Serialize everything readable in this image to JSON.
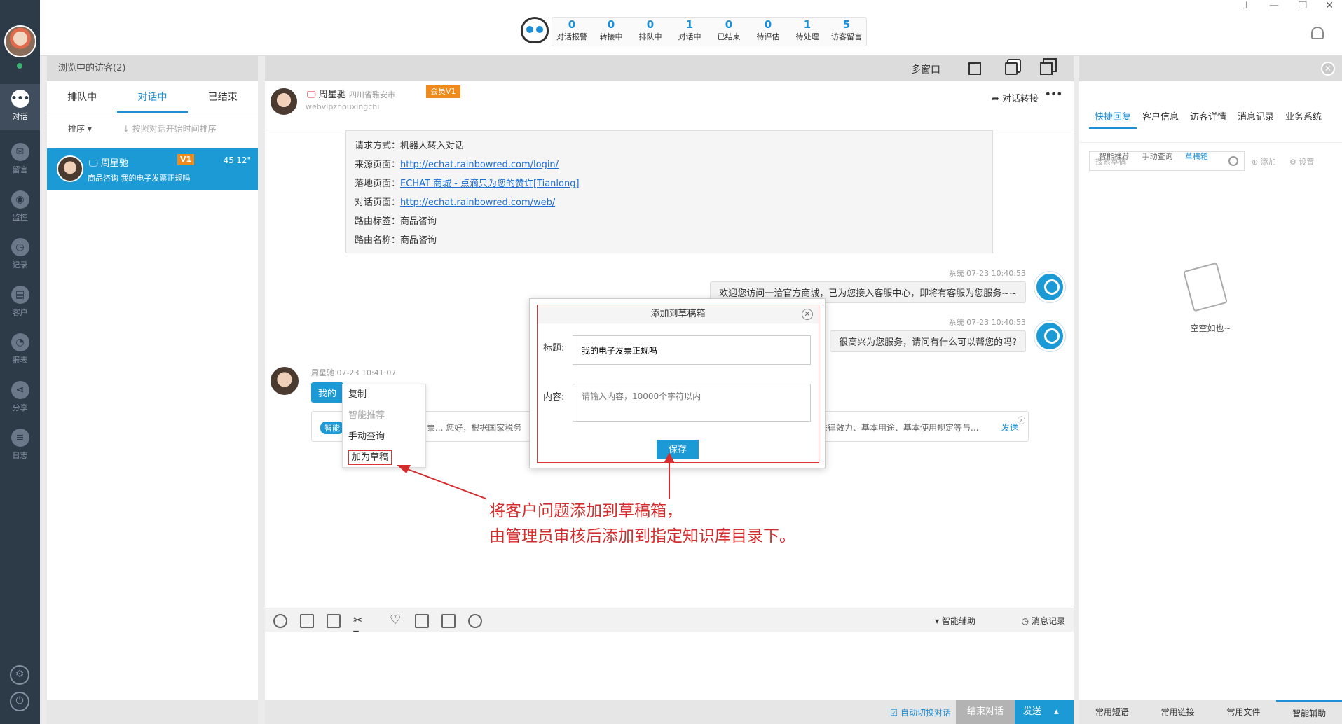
{
  "nav": {
    "items": [
      {
        "label": "对话",
        "icon": "chat-icon"
      },
      {
        "label": "留言",
        "icon": "mail-icon"
      },
      {
        "label": "监控",
        "icon": "eye-icon"
      },
      {
        "label": "记录",
        "icon": "clock-icon"
      },
      {
        "label": "客户",
        "icon": "contact-card-icon"
      },
      {
        "label": "报表",
        "icon": "pie-chart-icon"
      },
      {
        "label": "分享",
        "icon": "share-icon"
      },
      {
        "label": "日志",
        "icon": "clipboard-icon"
      }
    ]
  },
  "stats": [
    {
      "value": "0",
      "label": "对话报警"
    },
    {
      "value": "0",
      "label": "转接中"
    },
    {
      "value": "0",
      "label": "排队中"
    },
    {
      "value": "1",
      "label": "对话中"
    },
    {
      "value": "0",
      "label": "已结束"
    },
    {
      "value": "0",
      "label": "待评估"
    },
    {
      "value": "1",
      "label": "待处理"
    },
    {
      "value": "5",
      "label": "访客留言"
    }
  ],
  "visitors": {
    "header": "浏览中的访客(2)",
    "tabs": [
      "排队中",
      "对话中",
      "已结束"
    ],
    "sort_label": "排序",
    "sort_hint": "按照对话开始时间排序",
    "row": {
      "name": "周星驰",
      "badge": "V1",
      "duration": "45'12\"",
      "category": "商品咨询",
      "message": "我的电子发票正规吗"
    }
  },
  "chat": {
    "toolbar": {
      "multi_window": "多窗口"
    },
    "header": {
      "name": "周星驰",
      "location": "四川省雅安市",
      "vip": "会员V1",
      "userid": "webvipzhouxingchi",
      "transfer": "对话转接",
      "more": "•••"
    },
    "info": [
      {
        "key": "请求方式：",
        "value": "机器人转入对话",
        "link": false
      },
      {
        "key": "来源页面：",
        "value": "http://echat.rainbowred.com/login/",
        "link": true
      },
      {
        "key": "落地页面：",
        "value": "ECHAT 商城 - 点滴只为您的赞许[Tianlong]",
        "link": true
      },
      {
        "key": "对话页面：",
        "value": "http://echat.rainbowred.com/web/",
        "link": true
      },
      {
        "key": "路由标签：",
        "value": "商品咨询",
        "link": false
      },
      {
        "key": "路由名称：",
        "value": "商品咨询",
        "link": false
      }
    ],
    "sys1": {
      "meta": "系统 07-23 10:40:53",
      "text": "欢迎您访问一洽官方商城，已为您接入客服中心，即将有客服为您服务~~"
    },
    "sys2": {
      "meta": "系统 07-23 10:40:53",
      "text": "很高兴为您服务，请问有什么可以帮您的吗?"
    },
    "visitor_msg": {
      "meta": "周星驰 07-23 10:41:07",
      "text": "我的"
    },
    "smart": {
      "tag": "智能",
      "text1": "票... 您好，根据国家税务",
      "text2": "其法律效力、基本用途、基本使用规定等与...",
      "send": "发送"
    },
    "context_menu": [
      "复制",
      "智能推荐",
      "手动查询",
      "加为草稿"
    ],
    "compose_right": {
      "assist": "智能辅助",
      "history": "消息记录"
    },
    "footer": {
      "auto_switch": "自动切换对话",
      "end": "结束对话",
      "send": "发送"
    }
  },
  "modal": {
    "title": "添加到草稿箱",
    "title_label": "标题:",
    "title_value": "我的电子发票正规吗",
    "content_label": "内容:",
    "content_placeholder": "请输入内容，10000个字符以内",
    "save": "保存"
  },
  "annotation": {
    "line1": "将客户问题添加到草稿箱，",
    "line2": "由管理员审核后添加到指定知识库目录下。"
  },
  "right": {
    "tabs": [
      "快捷回复",
      "客户信息",
      "访客详情",
      "消息记录",
      "业务系统"
    ],
    "subtabs": [
      "智能推荐",
      "手动查询",
      "草稿箱"
    ],
    "search_placeholder": "搜索草稿",
    "add": "添加",
    "settings": "设置",
    "empty": "空空如也~",
    "footer_tabs": [
      "常用短语",
      "常用链接",
      "常用文件",
      "智能辅助"
    ]
  }
}
